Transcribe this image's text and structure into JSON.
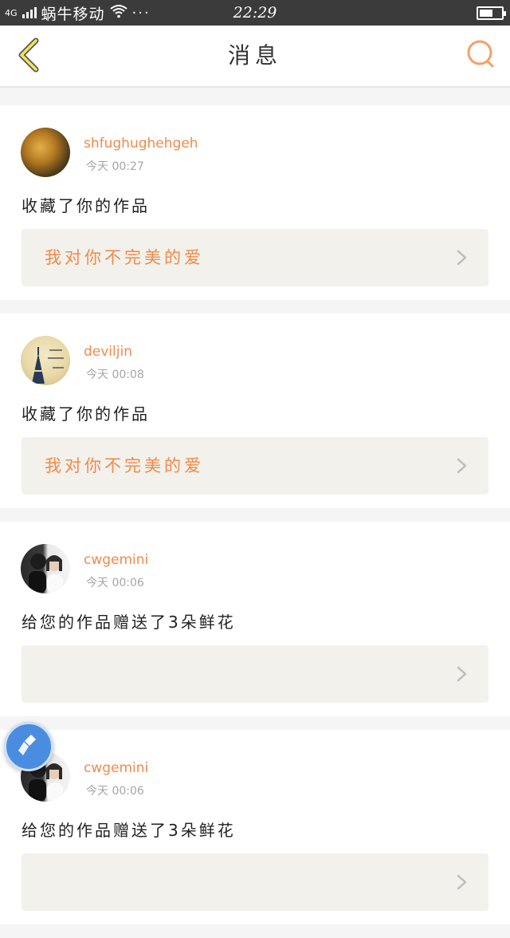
{
  "status_bar": {
    "network": "4G",
    "carrier": "蜗牛移动",
    "dots": "···",
    "time": "22:29"
  },
  "header": {
    "title": "消息",
    "back_icon": "chevron-left-icon",
    "search_icon": "search-icon",
    "accent_color": "#f08a4b"
  },
  "messages": [
    {
      "username": "shfughughehgeh",
      "time": "今天 00:27",
      "action": "收藏了你的作品",
      "work_title": "我对你不完美的爱"
    },
    {
      "username": "deviljin",
      "time": "今天 00:08",
      "action": "收藏了你的作品",
      "work_title": "我对你不完美的爱"
    },
    {
      "username": "cwgemini",
      "time": "今天 00:06",
      "action": "给您的作品赠送了3朵鲜花",
      "work_title": ""
    },
    {
      "username": "cwgemini",
      "time": "今天 00:06",
      "action": "给您的作品赠送了3朵鲜花",
      "work_title": ""
    }
  ],
  "floating_button": {
    "icon": "brush-icon",
    "color": "#4a8de0"
  }
}
